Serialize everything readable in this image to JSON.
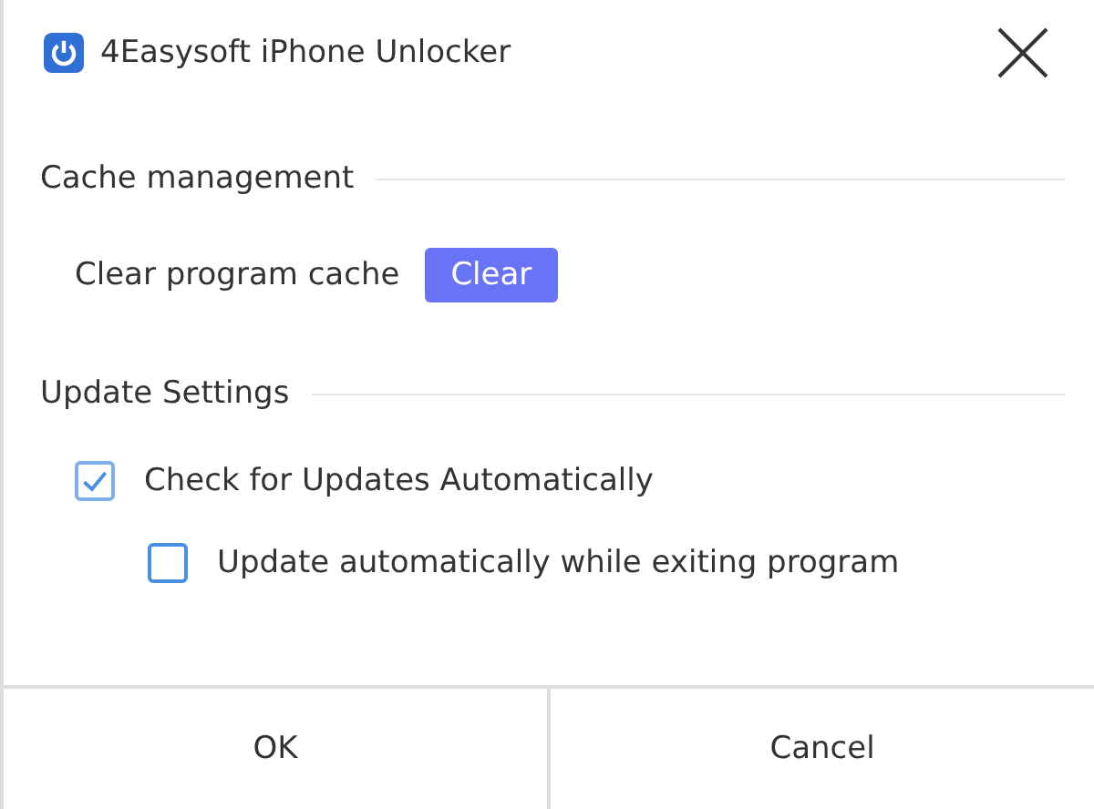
{
  "window": {
    "title": "4Easysoft iPhone Unlocker"
  },
  "cache": {
    "heading": "Cache management",
    "label": "Clear program cache",
    "button": "Clear"
  },
  "updates": {
    "heading": "Update Settings",
    "options": [
      {
        "label": "Check for Updates Automatically",
        "checked": true,
        "children": [
          {
            "label": "Update automatically while exiting program",
            "checked": false
          }
        ]
      }
    ]
  },
  "buttons": [
    "OK",
    "Cancel"
  ]
}
